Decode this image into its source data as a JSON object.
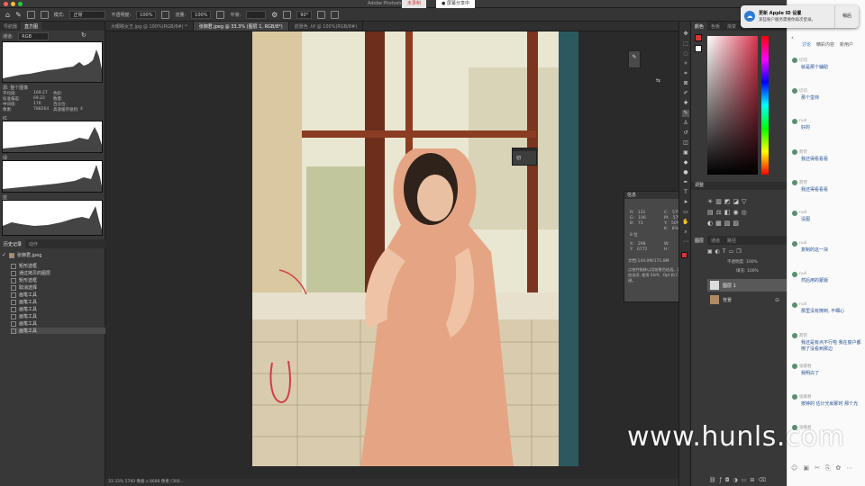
{
  "window": {
    "title": "Adobe Photoshop",
    "recording_badge": "未录制",
    "share_badge": "● 屏幕分享中"
  },
  "options_bar": {
    "mode_label": "模式:",
    "mode_value": "正常",
    "opacity_label": "不透明度:",
    "opacity_value": "100%",
    "flow_label": "流量:",
    "flow_value": "100%",
    "smooth_label": "平滑:",
    "angle_value": "90°"
  },
  "left_panel": {
    "tabs": [
      "导航器",
      "直方图"
    ],
    "channel_label": "通道:",
    "channel_value": "RGB",
    "source_label": "源:",
    "source_value": "整个图像",
    "stats": [
      [
        "平均值:",
        "169.27",
        "色阶:",
        ""
      ],
      [
        "标准偏差:",
        "69.22",
        "数量:",
        ""
      ],
      [
        "中间值:",
        "176",
        "百分位:",
        ""
      ],
      [
        "像素:",
        "788264",
        "高速缓存级别:",
        "4"
      ]
    ],
    "channel_names": [
      "红",
      "绿",
      "蓝"
    ],
    "history_tabs": [
      "历史记录",
      "动作"
    ],
    "snapshot": "张御君.jpeg",
    "history_items": [
      "矩形选框",
      "通过拷贝的图层",
      "矩形选框",
      "取消选择",
      "画笔工具",
      "画笔工具",
      "画笔工具",
      "画笔工具",
      "画笔工具",
      "画笔工具"
    ]
  },
  "doc_tabs": [
    "大眼睛女王.jpg @ 100%(RGB/8#) *",
    "张御君.jpeg @ 33.3% (图层 1, RGB/8*)",
    "前景色 .tif @ 100%(RGB/8#)"
  ],
  "status_bar": "33.33%  5760 像素 x 8688 像素 (300...",
  "mini_panel": {
    "label": "切"
  },
  "info_panel": {
    "title": "信息",
    "r": "131",
    "g": "106",
    "b": "73",
    "c": "57%",
    "m": "57%",
    "y": "50%",
    "k": "8%",
    "bits": "8 位",
    "x": "298",
    "yv": "6772",
    "doc": "文档:144.0M/171.8M",
    "tip": "点按并拖移以用前景色绘画。要用附加选项, 使用 Shift、Opt 和 Cmd 键。"
  },
  "right_panel": {
    "color_tabs": [
      "颜色",
      "色板",
      "渐变",
      "图案"
    ],
    "adjust_title": "调整",
    "layer_tabs": [
      "图层",
      "通道",
      "路径"
    ],
    "opacity_label": "不透明度:",
    "opacity_value": "100%",
    "fill_label": "填充:",
    "fill_value": "100%",
    "layers": [
      "图层 1",
      "背景"
    ],
    "fg_color": "#d9343a",
    "bg_color": "#ffffff"
  },
  "notification": {
    "title": "更新 Apple ID 设置",
    "body": "某些账户服务需要你再次登录。",
    "action": "稍后"
  },
  "chat": {
    "tabs": [
      "讨论",
      "精彩内容",
      "新用户"
    ],
    "messages": [
      {
        "name": "切切",
        "text": "就是那个辅助"
      },
      {
        "name": "切切",
        "text": "那个蛮帅"
      },
      {
        "name": "null",
        "text": "好的"
      },
      {
        "name": "荷宵",
        "text": "我还得看看看"
      },
      {
        "name": "荷宵",
        "text": "我还得看看看"
      },
      {
        "name": "null",
        "text": "没图"
      },
      {
        "name": "null",
        "text": "复制的这一块"
      },
      {
        "name": "null",
        "text": "然后用的蒙版"
      },
      {
        "name": "null",
        "text": "那里没有擦到, 不细心"
      },
      {
        "name": "荷宵",
        "text": "我还是有点不行啦 我在窗户都擦了没看到那边"
      },
      {
        "name": "张御君",
        "text": "我明白了"
      },
      {
        "name": "张御君",
        "text": "按钟的 估计光就那时 那个光"
      },
      {
        "name": "张御君",
        "text": ""
      }
    ]
  },
  "watermark": "www.hunls.com"
}
